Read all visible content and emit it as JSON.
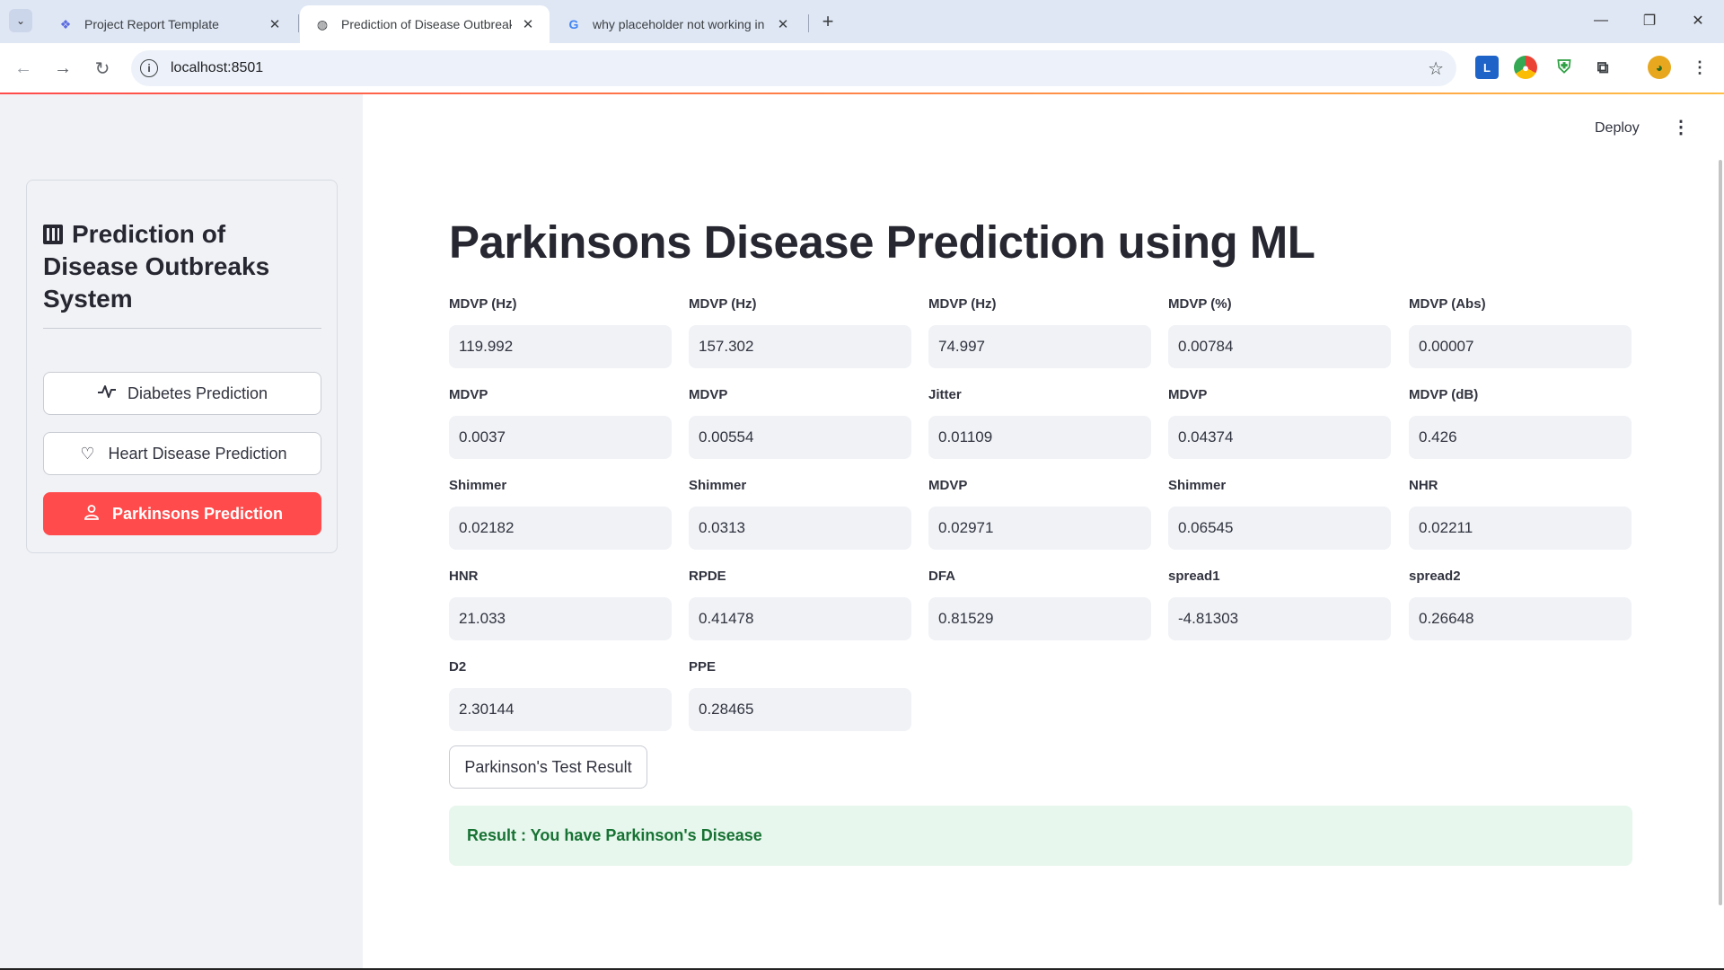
{
  "browser": {
    "tabs": [
      {
        "title": "Project Report Template",
        "icon": "stackby-icon"
      },
      {
        "title": "Prediction of Disease Outbreaks",
        "icon": "globe-icon"
      },
      {
        "title": "why placeholder not working in",
        "icon": "google-icon"
      }
    ],
    "url": "localhost:8501"
  },
  "sidebar": {
    "title": "Prediction of Disease Outbreaks System",
    "items": [
      {
        "label": "Diabetes Prediction",
        "icon": "activity-icon"
      },
      {
        "label": "Heart Disease Prediction",
        "icon": "heart-icon"
      },
      {
        "label": "Parkinsons Prediction",
        "icon": "person-icon"
      }
    ]
  },
  "header": {
    "deploy": "Deploy"
  },
  "main": {
    "title": "Parkinsons Disease Prediction using ML",
    "fields": [
      {
        "label": "MDVP (Hz)",
        "value": "119.992"
      },
      {
        "label": "MDVP (Hz)",
        "value": "157.302"
      },
      {
        "label": "MDVP (Hz)",
        "value": "74.997"
      },
      {
        "label": "MDVP (%)",
        "value": "0.00784"
      },
      {
        "label": "MDVP (Abs)",
        "value": "0.00007"
      },
      {
        "label": "MDVP",
        "value": "0.0037"
      },
      {
        "label": "MDVP",
        "value": "0.00554"
      },
      {
        "label": "Jitter",
        "value": "0.01109"
      },
      {
        "label": "MDVP",
        "value": "0.04374"
      },
      {
        "label": "MDVP (dB)",
        "value": "0.426"
      },
      {
        "label": "Shimmer",
        "value": "0.02182"
      },
      {
        "label": "Shimmer",
        "value": "0.0313"
      },
      {
        "label": "MDVP",
        "value": "0.02971"
      },
      {
        "label": "Shimmer",
        "value": "0.06545"
      },
      {
        "label": "NHR",
        "value": "0.02211"
      },
      {
        "label": "HNR",
        "value": "21.033"
      },
      {
        "label": "RPDE",
        "value": "0.41478"
      },
      {
        "label": "DFA",
        "value": "0.81529"
      },
      {
        "label": "spread1",
        "value": "-4.81303"
      },
      {
        "label": "spread2",
        "value": "0.26648"
      },
      {
        "label": "D2",
        "value": "2.30144"
      },
      {
        "label": "PPE",
        "value": "0.28465"
      }
    ],
    "button": "Parkinson's Test Result",
    "result": "Result : You have Parkinson's Disease"
  }
}
